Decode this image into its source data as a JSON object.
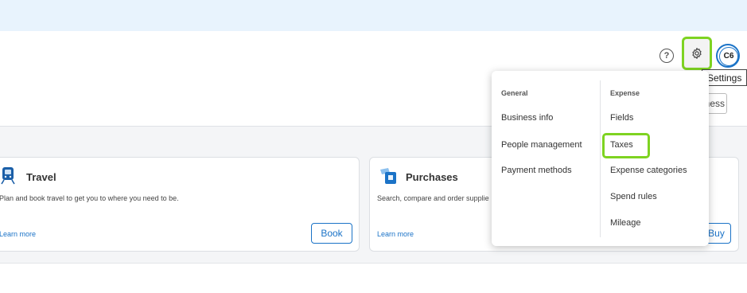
{
  "header": {
    "help_label": "?",
    "avatar_initials": "C6",
    "settings_tooltip": "Settings",
    "business_button_label": "ness"
  },
  "cards": {
    "travel": {
      "title": "Travel",
      "description": "Plan and book travel to get you to where you need to be.",
      "learn_more": "Learn more",
      "button_label": "Book"
    },
    "purchases": {
      "title": "Purchases",
      "description": "Search, compare and order supplie",
      "learn_more": "Learn more",
      "button_label": "Buy"
    }
  },
  "settings_menu": {
    "general": {
      "heading": "General",
      "items": [
        "Business info",
        "People management",
        "Payment methods"
      ]
    },
    "expense": {
      "heading": "Expense",
      "items": [
        "Fields",
        "Taxes",
        "Expense categories",
        "Spend rules",
        "Mileage"
      ]
    }
  },
  "colors": {
    "accent_blue": "#1b73c7",
    "highlight_green": "#7ed321",
    "banner_blue": "#e8f3fd"
  },
  "icons": {
    "help": "question-circle-icon",
    "settings": "gear-icon",
    "travel": "train-icon",
    "purchases": "shopping-bag-icon"
  }
}
